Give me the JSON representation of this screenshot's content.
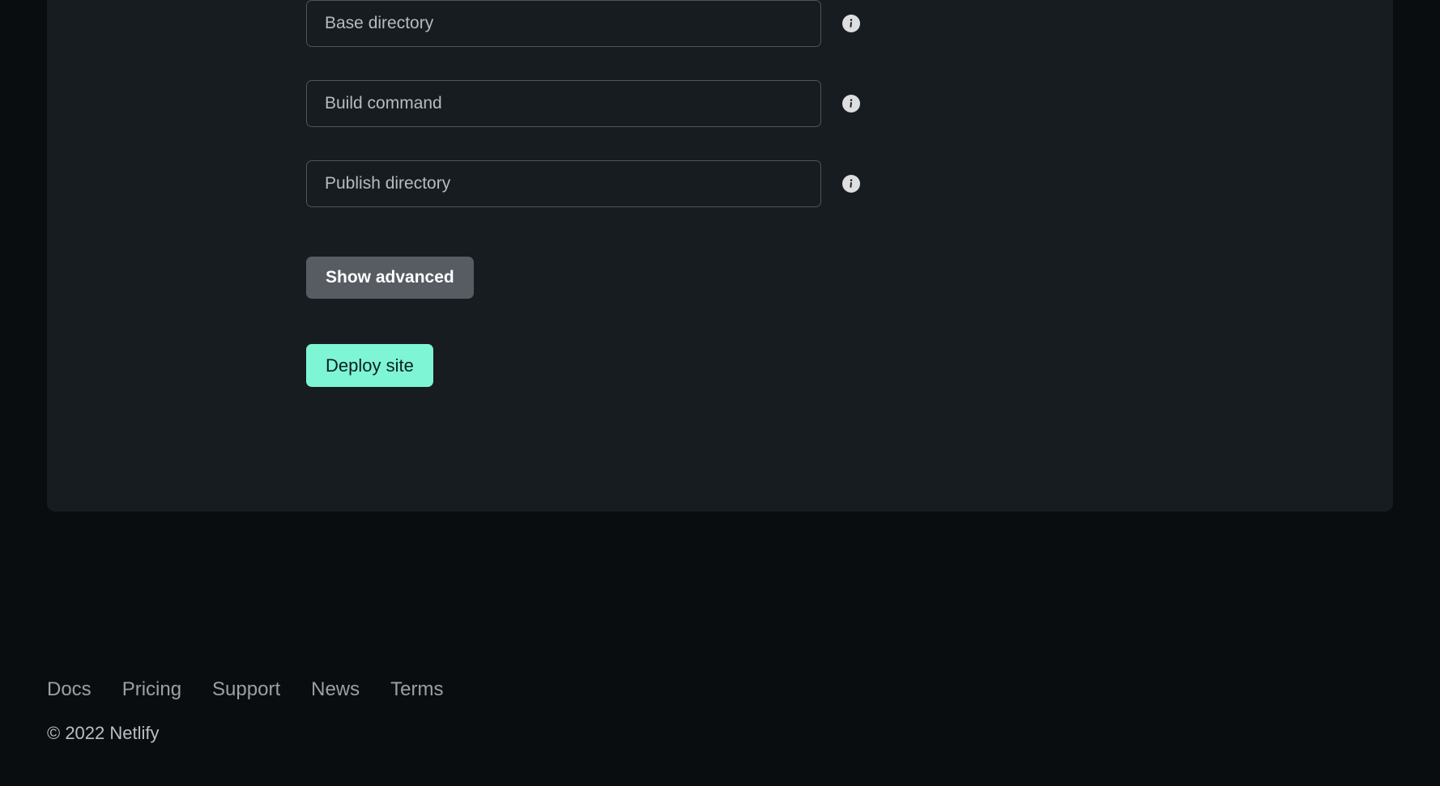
{
  "theme": {
    "page_background": "#090d10",
    "card_background": "#171c20",
    "input_border": "#4e555d",
    "placeholder_color": "#b6bbc0",
    "accent_teal": "#7ef5d4",
    "accent_teal_text": "#0d1f26",
    "secondary_button": "#575c63",
    "footer_link_color": "#9aa0a6",
    "info_icon_background": "#dcdee0"
  },
  "form": {
    "fields": [
      {
        "name": "base-directory",
        "placeholder": "Base directory",
        "value": "",
        "info_icon": "info-icon"
      },
      {
        "name": "build-command",
        "placeholder": "Build command",
        "value": "",
        "info_icon": "info-icon"
      },
      {
        "name": "publish-directory",
        "placeholder": "Publish directory",
        "value": "",
        "info_icon": "info-icon"
      }
    ],
    "show_advanced_label": "Show advanced",
    "deploy_label": "Deploy site"
  },
  "footer": {
    "links": [
      {
        "label": "Docs"
      },
      {
        "label": "Pricing"
      },
      {
        "label": "Support"
      },
      {
        "label": "News"
      },
      {
        "label": "Terms"
      }
    ],
    "copyright": "© 2022 Netlify"
  }
}
